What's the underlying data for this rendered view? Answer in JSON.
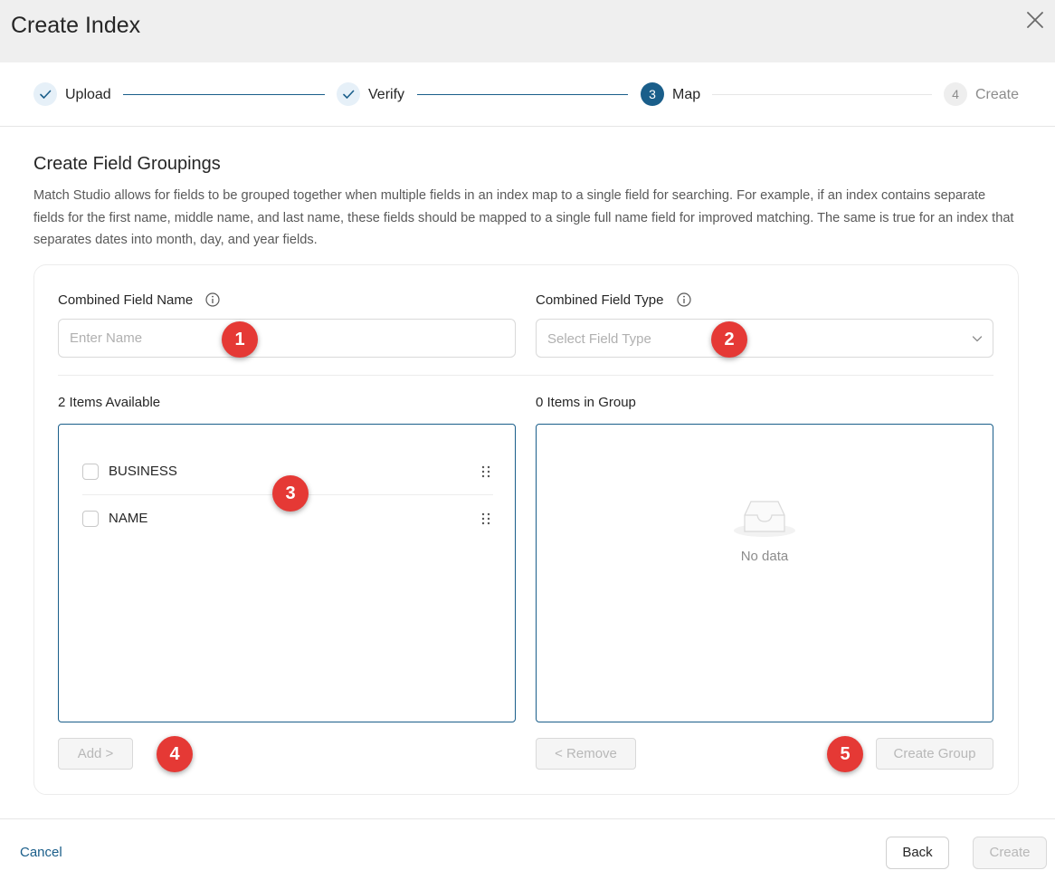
{
  "dialog": {
    "title": "Create Index"
  },
  "steps": [
    {
      "label": "Upload",
      "number": "1",
      "status": "done"
    },
    {
      "label": "Verify",
      "number": "2",
      "status": "done"
    },
    {
      "label": "Map",
      "number": "3",
      "status": "active"
    },
    {
      "label": "Create",
      "number": "4",
      "status": "pending"
    }
  ],
  "section": {
    "title": "Create Field Groupings",
    "description": "Match Studio allows for fields to be grouped together when multiple fields in an index map to a single field for searching. For example, if an index contains separate fields for the first name, middle name, and last name, these fields should be mapped to a single full name field for improved matching. The same is true for an index that separates dates into month, day, and year fields."
  },
  "form": {
    "name_label": "Combined Field Name",
    "name_placeholder": "Enter Name",
    "name_value": "",
    "type_label": "Combined Field Type",
    "type_placeholder": "Select Field Type"
  },
  "available": {
    "count_label": "2 Items Available",
    "items": [
      {
        "label": "BUSINESS",
        "checked": false
      },
      {
        "label": "NAME",
        "checked": false
      }
    ]
  },
  "group": {
    "count_label": "0 Items in Group",
    "empty_text": "No data"
  },
  "buttons": {
    "add": "Add >",
    "remove": "< Remove",
    "create_group": "Create Group"
  },
  "markers": [
    "1",
    "2",
    "3",
    "4",
    "5"
  ],
  "footer": {
    "cancel": "Cancel",
    "back": "Back",
    "create": "Create"
  },
  "colors": {
    "accent": "#1a5e8a",
    "marker": "#e53935",
    "header_bg": "#efefef"
  },
  "icons": {
    "close": "close-icon",
    "check": "check-icon",
    "info": "info-icon",
    "chevron": "chevron-down-icon",
    "drag": "drag-handle-icon",
    "empty": "empty-inbox-icon"
  }
}
